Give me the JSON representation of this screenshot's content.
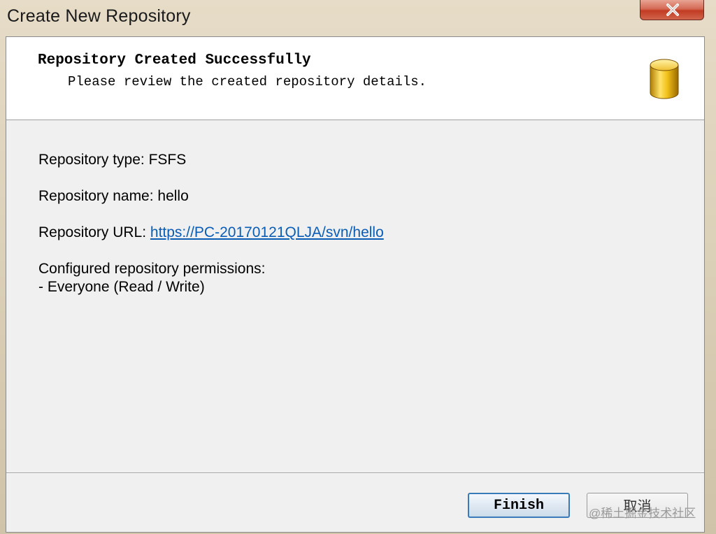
{
  "window": {
    "title": "Create New Repository"
  },
  "header": {
    "title": "Repository Created Successfully",
    "subtitle": "Please review the created repository details.",
    "icon": "database-icon"
  },
  "details": {
    "type_line": "Repository type: FSFS",
    "name_line": "Repository name: hello",
    "url_label": "Repository URL: ",
    "url": "https://PC-20170121QLJA/svn/hello",
    "permissions_label": "Configured repository permissions:",
    "permissions": [
      "- Everyone (Read / Write)"
    ]
  },
  "buttons": {
    "finish": "Finish",
    "cancel": "取消"
  },
  "watermark": "@稀土掘金技术社区",
  "colors": {
    "link": "#0a5db5",
    "close_button": "#c23b22",
    "finish_border": "#3a7ab8"
  }
}
